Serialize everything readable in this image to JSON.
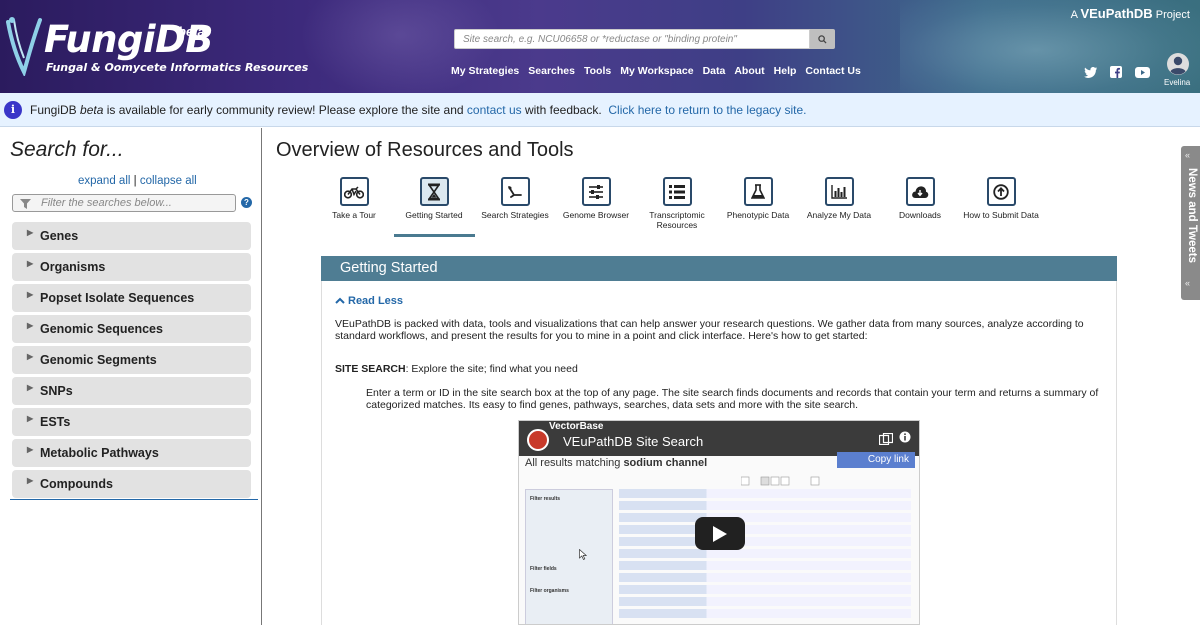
{
  "header": {
    "logo_title": "FungiDB",
    "logo_beta": "beta",
    "logo_subtitle": "Fungal & Oomycete Informatics Resources",
    "project_prefix": "A",
    "project_name": "VEuPathDB",
    "project_suffix": "Project",
    "search_placeholder": "Site search, e.g. NCU06658 or *reductase or \"binding protein\"",
    "menu": [
      "My Strategies",
      "Searches",
      "Tools",
      "My Workspace",
      "Data",
      "About",
      "Help",
      "Contact Us"
    ],
    "social_icons": [
      "twitter-icon",
      "facebook-icon",
      "youtube-icon"
    ],
    "username": "Evelina"
  },
  "announcement": {
    "prefix": "FungiDB",
    "beta": "beta",
    "text1": "is available for early community review!  Please explore the site and",
    "contact_link": "contact us",
    "text2": "with feedback.",
    "legacy_link": "Click here to return to the legacy site."
  },
  "sidebar": {
    "title": "Search for...",
    "expand_all": "expand all",
    "separator": "|",
    "collapse_all": "collapse all",
    "filter_placeholder": "Filter the searches below...",
    "categories": [
      "Genes",
      "Organisms",
      "Popset Isolate Sequences",
      "Genomic Sequences",
      "Genomic Segments",
      "SNPs",
      "ESTs",
      "Metabolic Pathways",
      "Compounds"
    ]
  },
  "main": {
    "title": "Overview of Resources and Tools",
    "tiles": [
      {
        "label": "Take a Tour",
        "icon": "motorcycle-icon"
      },
      {
        "label": "Getting Started",
        "icon": "hourglass-icon"
      },
      {
        "label": "Search Strategies",
        "icon": "strategy-icon"
      },
      {
        "label": "Genome Browser",
        "icon": "sliders-icon"
      },
      {
        "label": "Transcriptomic Resources",
        "icon": "list-icon"
      },
      {
        "label": "Phenotypic Data",
        "icon": "flask-icon"
      },
      {
        "label": "Analyze My Data",
        "icon": "bar-chart-icon"
      },
      {
        "label": "Downloads",
        "icon": "cloud-download-icon"
      },
      {
        "label": "How to Submit Data",
        "icon": "upload-icon"
      }
    ],
    "panel_title": "Getting Started",
    "read_less": "Read Less",
    "intro": "VEuPathDB is packed with data, tools and visualizations that can help answer your research questions. We gather data from many sources, analyze according to standard workflows, and present the results for you to mine in a point and click interface. Here's how to get started:",
    "site_search_label": "SITE SEARCH",
    "site_search_text": ": Explore the site; find what you need",
    "site_search_desc": "Enter a term or ID in the site search box at the top of any page. The site search finds documents and records that contain your term and returns a summary of categorized matches. Its easy to find genes, pathways, searches, data sets and more with the site search.",
    "video": {
      "brand": "VectorBase",
      "title": "VEuPathDB Site Search",
      "results_prefix": "All results matching",
      "results_term": "sodium channel",
      "copy_link": "Copy link",
      "filter_results": "Filter results",
      "filter_fields": "Filter fields",
      "filter_organisms": "Filter organisms"
    }
  },
  "news_tab": {
    "label": "News and Tweets"
  }
}
